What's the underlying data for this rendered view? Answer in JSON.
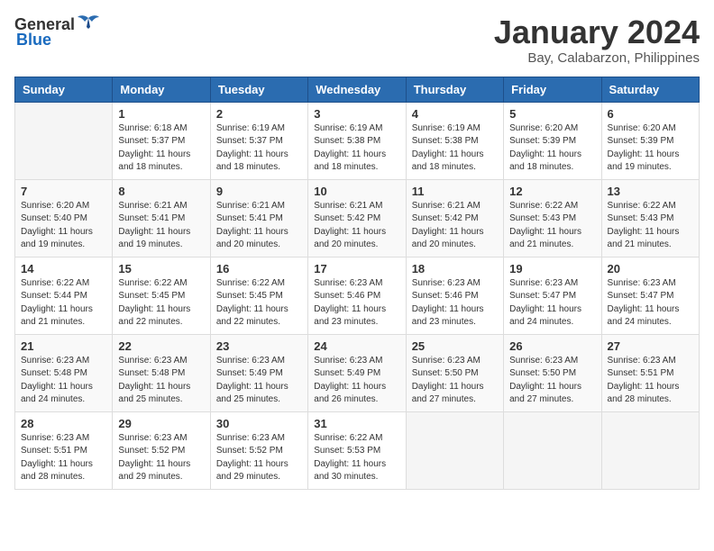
{
  "header": {
    "logo_general": "General",
    "logo_blue": "Blue",
    "title": "January 2024",
    "subtitle": "Bay, Calabarzon, Philippines"
  },
  "days_of_week": [
    "Sunday",
    "Monday",
    "Tuesday",
    "Wednesday",
    "Thursday",
    "Friday",
    "Saturday"
  ],
  "weeks": [
    [
      {
        "day": "",
        "info": ""
      },
      {
        "day": "1",
        "info": "Sunrise: 6:18 AM\nSunset: 5:37 PM\nDaylight: 11 hours\nand 18 minutes."
      },
      {
        "day": "2",
        "info": "Sunrise: 6:19 AM\nSunset: 5:37 PM\nDaylight: 11 hours\nand 18 minutes."
      },
      {
        "day": "3",
        "info": "Sunrise: 6:19 AM\nSunset: 5:38 PM\nDaylight: 11 hours\nand 18 minutes."
      },
      {
        "day": "4",
        "info": "Sunrise: 6:19 AM\nSunset: 5:38 PM\nDaylight: 11 hours\nand 18 minutes."
      },
      {
        "day": "5",
        "info": "Sunrise: 6:20 AM\nSunset: 5:39 PM\nDaylight: 11 hours\nand 18 minutes."
      },
      {
        "day": "6",
        "info": "Sunrise: 6:20 AM\nSunset: 5:39 PM\nDaylight: 11 hours\nand 19 minutes."
      }
    ],
    [
      {
        "day": "7",
        "info": "Sunrise: 6:20 AM\nSunset: 5:40 PM\nDaylight: 11 hours\nand 19 minutes."
      },
      {
        "day": "8",
        "info": "Sunrise: 6:21 AM\nSunset: 5:41 PM\nDaylight: 11 hours\nand 19 minutes."
      },
      {
        "day": "9",
        "info": "Sunrise: 6:21 AM\nSunset: 5:41 PM\nDaylight: 11 hours\nand 20 minutes."
      },
      {
        "day": "10",
        "info": "Sunrise: 6:21 AM\nSunset: 5:42 PM\nDaylight: 11 hours\nand 20 minutes."
      },
      {
        "day": "11",
        "info": "Sunrise: 6:21 AM\nSunset: 5:42 PM\nDaylight: 11 hours\nand 20 minutes."
      },
      {
        "day": "12",
        "info": "Sunrise: 6:22 AM\nSunset: 5:43 PM\nDaylight: 11 hours\nand 21 minutes."
      },
      {
        "day": "13",
        "info": "Sunrise: 6:22 AM\nSunset: 5:43 PM\nDaylight: 11 hours\nand 21 minutes."
      }
    ],
    [
      {
        "day": "14",
        "info": "Sunrise: 6:22 AM\nSunset: 5:44 PM\nDaylight: 11 hours\nand 21 minutes."
      },
      {
        "day": "15",
        "info": "Sunrise: 6:22 AM\nSunset: 5:45 PM\nDaylight: 11 hours\nand 22 minutes."
      },
      {
        "day": "16",
        "info": "Sunrise: 6:22 AM\nSunset: 5:45 PM\nDaylight: 11 hours\nand 22 minutes."
      },
      {
        "day": "17",
        "info": "Sunrise: 6:23 AM\nSunset: 5:46 PM\nDaylight: 11 hours\nand 23 minutes."
      },
      {
        "day": "18",
        "info": "Sunrise: 6:23 AM\nSunset: 5:46 PM\nDaylight: 11 hours\nand 23 minutes."
      },
      {
        "day": "19",
        "info": "Sunrise: 6:23 AM\nSunset: 5:47 PM\nDaylight: 11 hours\nand 24 minutes."
      },
      {
        "day": "20",
        "info": "Sunrise: 6:23 AM\nSunset: 5:47 PM\nDaylight: 11 hours\nand 24 minutes."
      }
    ],
    [
      {
        "day": "21",
        "info": "Sunrise: 6:23 AM\nSunset: 5:48 PM\nDaylight: 11 hours\nand 24 minutes."
      },
      {
        "day": "22",
        "info": "Sunrise: 6:23 AM\nSunset: 5:48 PM\nDaylight: 11 hours\nand 25 minutes."
      },
      {
        "day": "23",
        "info": "Sunrise: 6:23 AM\nSunset: 5:49 PM\nDaylight: 11 hours\nand 25 minutes."
      },
      {
        "day": "24",
        "info": "Sunrise: 6:23 AM\nSunset: 5:49 PM\nDaylight: 11 hours\nand 26 minutes."
      },
      {
        "day": "25",
        "info": "Sunrise: 6:23 AM\nSunset: 5:50 PM\nDaylight: 11 hours\nand 27 minutes."
      },
      {
        "day": "26",
        "info": "Sunrise: 6:23 AM\nSunset: 5:50 PM\nDaylight: 11 hours\nand 27 minutes."
      },
      {
        "day": "27",
        "info": "Sunrise: 6:23 AM\nSunset: 5:51 PM\nDaylight: 11 hours\nand 28 minutes."
      }
    ],
    [
      {
        "day": "28",
        "info": "Sunrise: 6:23 AM\nSunset: 5:51 PM\nDaylight: 11 hours\nand 28 minutes."
      },
      {
        "day": "29",
        "info": "Sunrise: 6:23 AM\nSunset: 5:52 PM\nDaylight: 11 hours\nand 29 minutes."
      },
      {
        "day": "30",
        "info": "Sunrise: 6:23 AM\nSunset: 5:52 PM\nDaylight: 11 hours\nand 29 minutes."
      },
      {
        "day": "31",
        "info": "Sunrise: 6:22 AM\nSunset: 5:53 PM\nDaylight: 11 hours\nand 30 minutes."
      },
      {
        "day": "",
        "info": ""
      },
      {
        "day": "",
        "info": ""
      },
      {
        "day": "",
        "info": ""
      }
    ]
  ]
}
